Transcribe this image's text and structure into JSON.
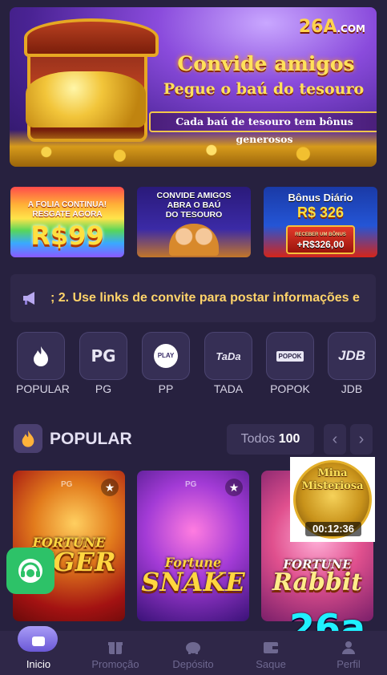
{
  "hero": {
    "brand": "26A",
    "brand_suffix": ".COM",
    "headline": "Convide amigos",
    "subheadline": "Pegue o baú do tesouro",
    "pill": "Cada baú de tesouro tem bônus generosos"
  },
  "promos": [
    {
      "line1": "A FOLIA CONTINUA!",
      "line2": "RESGATE AGORA",
      "big": "R$99"
    },
    {
      "line1": "CONVIDE AMIGOS",
      "line2": "ABRA O BAÚ",
      "line3": "DO TESOURO"
    },
    {
      "line1": "Bônus Diário",
      "amount": "R$ 326",
      "small": "RECEBER UM BÔNUS",
      "bonus": "+R$326,00"
    }
  ],
  "marquee": {
    "text": "; 2. Use links de convite para postar informações e"
  },
  "categories": [
    {
      "label": "POPULAR",
      "icon": "flame-icon"
    },
    {
      "label": "PG",
      "icon": "pg-logo-icon"
    },
    {
      "label": "PP",
      "icon": "pp-play-icon"
    },
    {
      "label": "TADA",
      "icon": "tada-logo-icon"
    },
    {
      "label": "POPOK",
      "icon": "popok-logo-icon"
    },
    {
      "label": "JDB",
      "icon": "jdb-logo-icon"
    }
  ],
  "section": {
    "title": "POPULAR",
    "todos_label": "Todos",
    "todos_count": "100"
  },
  "games": [
    {
      "provider": "PG",
      "title_top": "FORTUNE",
      "title_bottom": "TIGER"
    },
    {
      "provider": "PG",
      "title_top": "Fortune",
      "title_bottom": "SNAKE"
    },
    {
      "provider": "",
      "title_top": "FORTUNE",
      "title_bottom": "Rabbit"
    }
  ],
  "mina": {
    "line1": "Mina",
    "line2": "Misteriosa",
    "timer": "00:12:36"
  },
  "watermark": "26a",
  "bottom_nav": [
    {
      "label": "Inicio",
      "icon": "home-icon"
    },
    {
      "label": "Promoção",
      "icon": "gift-icon"
    },
    {
      "label": "Depósito",
      "icon": "piggy-bank-icon"
    },
    {
      "label": "Saque",
      "icon": "wallet-icon"
    },
    {
      "label": "Perfil",
      "icon": "user-icon"
    }
  ],
  "colors": {
    "background": "#27213f",
    "accent_gold": "#ffd46a",
    "support_green": "#2dc268",
    "watermark_cyan": "#1ff0ff"
  }
}
